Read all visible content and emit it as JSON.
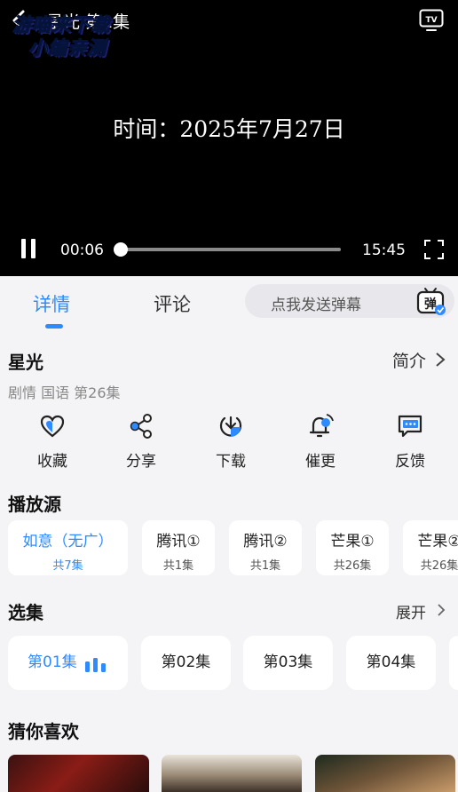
{
  "player": {
    "episode_title": "星光 第1集",
    "watermark_line1": "游喵来下载",
    "watermark_line2": "小编亲测",
    "timestamp_text": "时间：2025年7月27日",
    "current_time": "00:06",
    "total_time": "15:45",
    "progress_fraction": 0.006
  },
  "tabs": [
    {
      "label": "详情",
      "active": true
    },
    {
      "label": "评论",
      "active": false
    }
  ],
  "danmu": {
    "placeholder": "点我发送弹幕",
    "icon_text": "弹"
  },
  "detail": {
    "title": "星光",
    "intro_label": "简介",
    "meta": "剧情 国语 第26集"
  },
  "actions": [
    {
      "label": "收藏",
      "icon": "heart-icon"
    },
    {
      "label": "分享",
      "icon": "share-icon"
    },
    {
      "label": "下载",
      "icon": "download-icon"
    },
    {
      "label": "催更",
      "icon": "bell-icon"
    },
    {
      "label": "反馈",
      "icon": "feedback-icon"
    }
  ],
  "sources": {
    "title": "播放源",
    "items": [
      {
        "name": "如意（无广）",
        "count": "共7集",
        "active": true
      },
      {
        "name": "腾讯①",
        "count": "共1集",
        "active": false
      },
      {
        "name": "腾讯②",
        "count": "共1集",
        "active": false
      },
      {
        "name": "芒果①",
        "count": "共26集",
        "active": false
      },
      {
        "name": "芒果②",
        "count": "共26集",
        "active": false
      }
    ]
  },
  "episodes": {
    "title": "选集",
    "expand_label": "展开",
    "items": [
      {
        "label": "第01集",
        "active": true
      },
      {
        "label": "第02集",
        "active": false
      },
      {
        "label": "第03集",
        "active": false
      },
      {
        "label": "第04集",
        "active": false
      }
    ]
  },
  "recommend": {
    "title": "猜你喜欢"
  },
  "colors": {
    "accent": "#2e8bff",
    "background": "#f4f4f6",
    "player": "#000000"
  }
}
